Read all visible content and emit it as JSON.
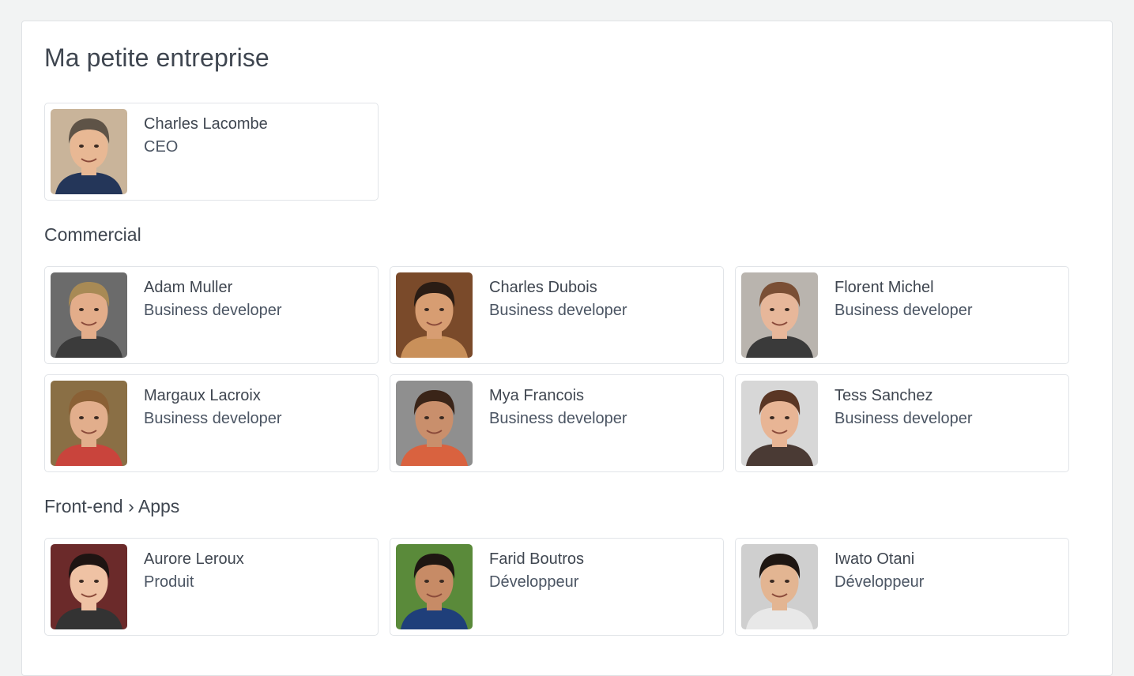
{
  "company": {
    "title": "Ma petite entreprise"
  },
  "ceo": {
    "name": "Charles Lacombe",
    "role": "CEO",
    "avatar": {
      "bg": "#c9b49a",
      "skin": "#e8b894",
      "hair": "#5e5347",
      "shirt": "#243659"
    }
  },
  "sections": [
    {
      "title": "Commercial",
      "members": [
        {
          "name": "Adam Muller",
          "role": "Business developer",
          "avatar": {
            "bg": "#6b6b6b",
            "skin": "#e3ad8a",
            "hair": "#a88a55",
            "shirt": "#3b3b3b"
          }
        },
        {
          "name": "Charles Dubois",
          "role": "Business developer",
          "avatar": {
            "bg": "#7a4a2a",
            "skin": "#d79d72",
            "hair": "#2a1c14",
            "shirt": "#c9905a"
          }
        },
        {
          "name": "Florent Michel",
          "role": "Business developer",
          "avatar": {
            "bg": "#b9b4ae",
            "skin": "#e7b79a",
            "hair": "#7a4f35",
            "shirt": "#3a3a3a"
          }
        },
        {
          "name": "Margaux Lacroix",
          "role": "Business developer",
          "avatar": {
            "bg": "#8a6f45",
            "skin": "#e2ae8c",
            "hair": "#8a6035",
            "shirt": "#c9443c"
          }
        },
        {
          "name": "Mya Francois",
          "role": "Business developer",
          "avatar": {
            "bg": "#8f8f8f",
            "skin": "#c98f6c",
            "hair": "#3a2418",
            "shirt": "#d9623f"
          }
        },
        {
          "name": "Tess Sanchez",
          "role": "Business developer",
          "avatar": {
            "bg": "#d7d7d7",
            "skin": "#e8b595",
            "hair": "#5a3624",
            "shirt": "#4a3a34"
          }
        }
      ]
    },
    {
      "title": "Front-end › Apps",
      "members": [
        {
          "name": "Aurore Leroux",
          "role": "Produit",
          "avatar": {
            "bg": "#6b2a2a",
            "skin": "#efc2a4",
            "hair": "#1e1412",
            "shirt": "#333333"
          }
        },
        {
          "name": "Farid Boutros",
          "role": "Développeur",
          "avatar": {
            "bg": "#5a8a3a",
            "skin": "#c78b66",
            "hair": "#1e1612",
            "shirt": "#1f3f7a"
          }
        },
        {
          "name": "Iwato Otani",
          "role": "Développeur",
          "avatar": {
            "bg": "#cfcfcf",
            "skin": "#e3b592",
            "hair": "#1e1612",
            "shirt": "#e8e8e8"
          }
        }
      ]
    }
  ]
}
